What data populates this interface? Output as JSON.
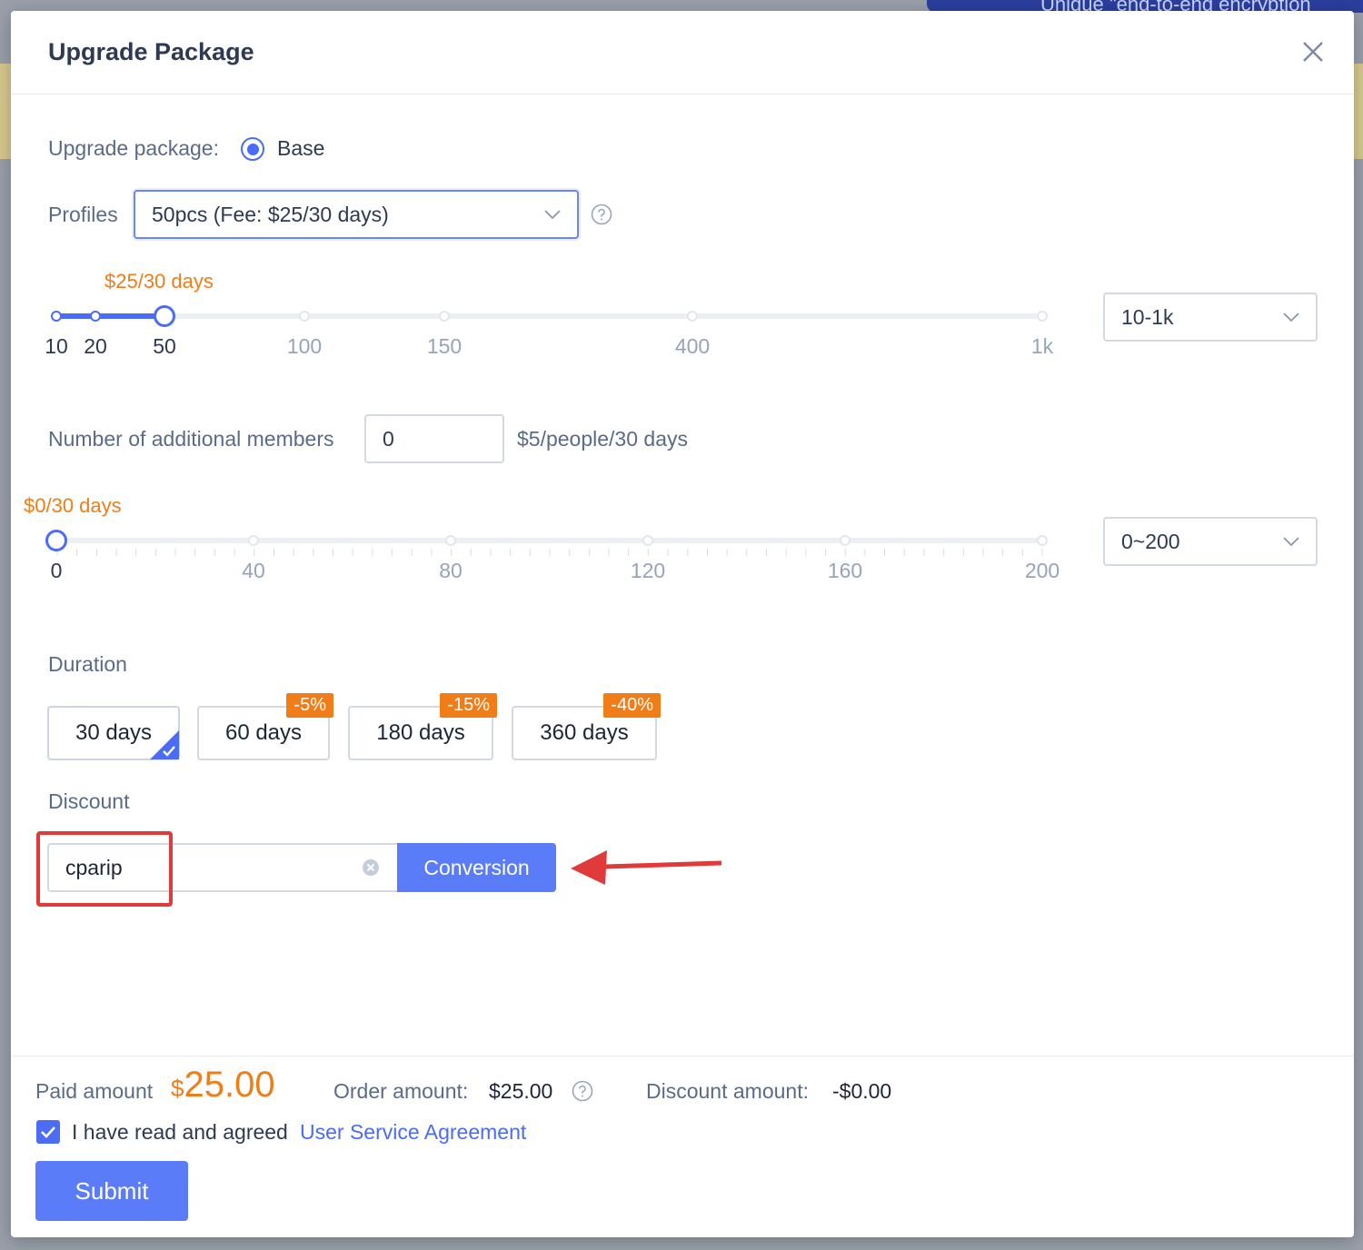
{
  "background": {
    "banner_text": "Unique \"end-to-end encryption"
  },
  "modal": {
    "title": "Upgrade Package"
  },
  "upgrade_package": {
    "label": "Upgrade package:",
    "option": "Base"
  },
  "profiles": {
    "label": "Profiles",
    "selected": "50pcs (Fee: $25/30 days)",
    "price_tooltip": "$25/30 days",
    "range_select": "10-1k",
    "slider": {
      "ticks": [
        "10",
        "20",
        "50",
        "100",
        "150",
        "400",
        "1k"
      ],
      "selected": "50",
      "level": 0.11
    }
  },
  "members": {
    "label": "Number of additional members",
    "value": "0",
    "rate": "$5/people/30 days",
    "price_tooltip": "$0/30 days",
    "range_select": "0~200",
    "slider": {
      "ticks": [
        "0",
        "40",
        "80",
        "120",
        "160",
        "200"
      ],
      "value": 0,
      "max": 200
    }
  },
  "duration": {
    "label": "Duration",
    "options": [
      {
        "label": "30 days",
        "badge": "",
        "selected": true
      },
      {
        "label": "60 days",
        "badge": "-5%",
        "selected": false
      },
      {
        "label": "180 days",
        "badge": "-15%",
        "selected": false
      },
      {
        "label": "360 days",
        "badge": "-40%",
        "selected": false
      }
    ]
  },
  "discount": {
    "label": "Discount",
    "code": "cparip",
    "button": "Conversion"
  },
  "footer": {
    "paid_label": "Paid amount",
    "paid_currency": "$",
    "paid_value": "25.00",
    "order_label": "Order amount:",
    "order_value": "$25.00",
    "discount_label": "Discount amount:",
    "discount_value": "-$0.00",
    "agree_text": "I have read and agreed",
    "agreement_link": "User Service Agreement",
    "submit": "Submit"
  },
  "colors": {
    "accent": "#4a6cf7",
    "orange": "#f07d18",
    "highlight": "#e03a3a"
  }
}
